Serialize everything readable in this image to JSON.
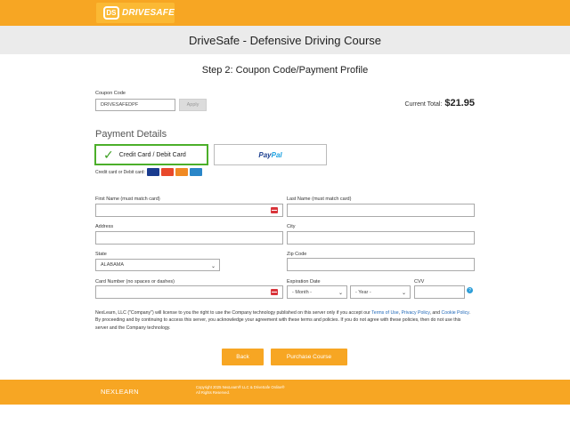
{
  "header": {
    "logo_mark": "DS",
    "logo_text": "DRIVESAFE",
    "title": "DriveSafe - Defensive Driving Course"
  },
  "step_title": "Step 2: Coupon Code/Payment Profile",
  "coupon": {
    "label": "Coupon Code",
    "value": "DRIVESAFEDPF",
    "apply_label": "Apply"
  },
  "total": {
    "label": "Current Total:",
    "amount": "$21.95"
  },
  "payment": {
    "section_title": "Payment Details",
    "credit_label": "Credit Card / Debit Card",
    "paypal_pay": "Pay",
    "paypal_pal": "Pal",
    "cards_label": "Credit card or Debit card:",
    "cards": [
      {
        "name": "visa",
        "color": "#1a3c8f"
      },
      {
        "name": "mastercard",
        "color": "#e8482b"
      },
      {
        "name": "discover",
        "color": "#f08a24"
      },
      {
        "name": "amex",
        "color": "#2a86c8"
      }
    ]
  },
  "form": {
    "first_name_label": "First Name (must match card)",
    "last_name_label": "Last Name (must match card)",
    "address_label": "Address",
    "city_label": "City",
    "state_label": "State",
    "state_value": "ALABAMA",
    "zip_label": "Zip Code",
    "card_number_label": "Card Number (no spaces or dashes)",
    "expiration_label": "Expiration Date",
    "month_value": "- Month -",
    "year_value": "- Year -",
    "cvv_label": "CVV"
  },
  "legal": {
    "part1": "NexLearn, LLC (\"Company\") will license to you the right to use the Company technology published on this server only if you accept our ",
    "terms": "Terms of Use",
    "sep1": ", ",
    "privacy": "Privacy Policy",
    "sep2": ", and ",
    "cookie": "Cookie Policy",
    "part2": ". By proceeding and by continuing to access this server, you acknowledge your agreement with these terms and policies. If you do not agree with these policies, then do not use this server and the Company technology."
  },
  "buttons": {
    "back": "Back",
    "purchase": "Purchase Course"
  },
  "footer": {
    "logo": "NEXLEARN",
    "copyright": "Copyright 2025 NexLearn® LLC & DriveSafe Online®",
    "rights": "All Rights Reserved."
  }
}
